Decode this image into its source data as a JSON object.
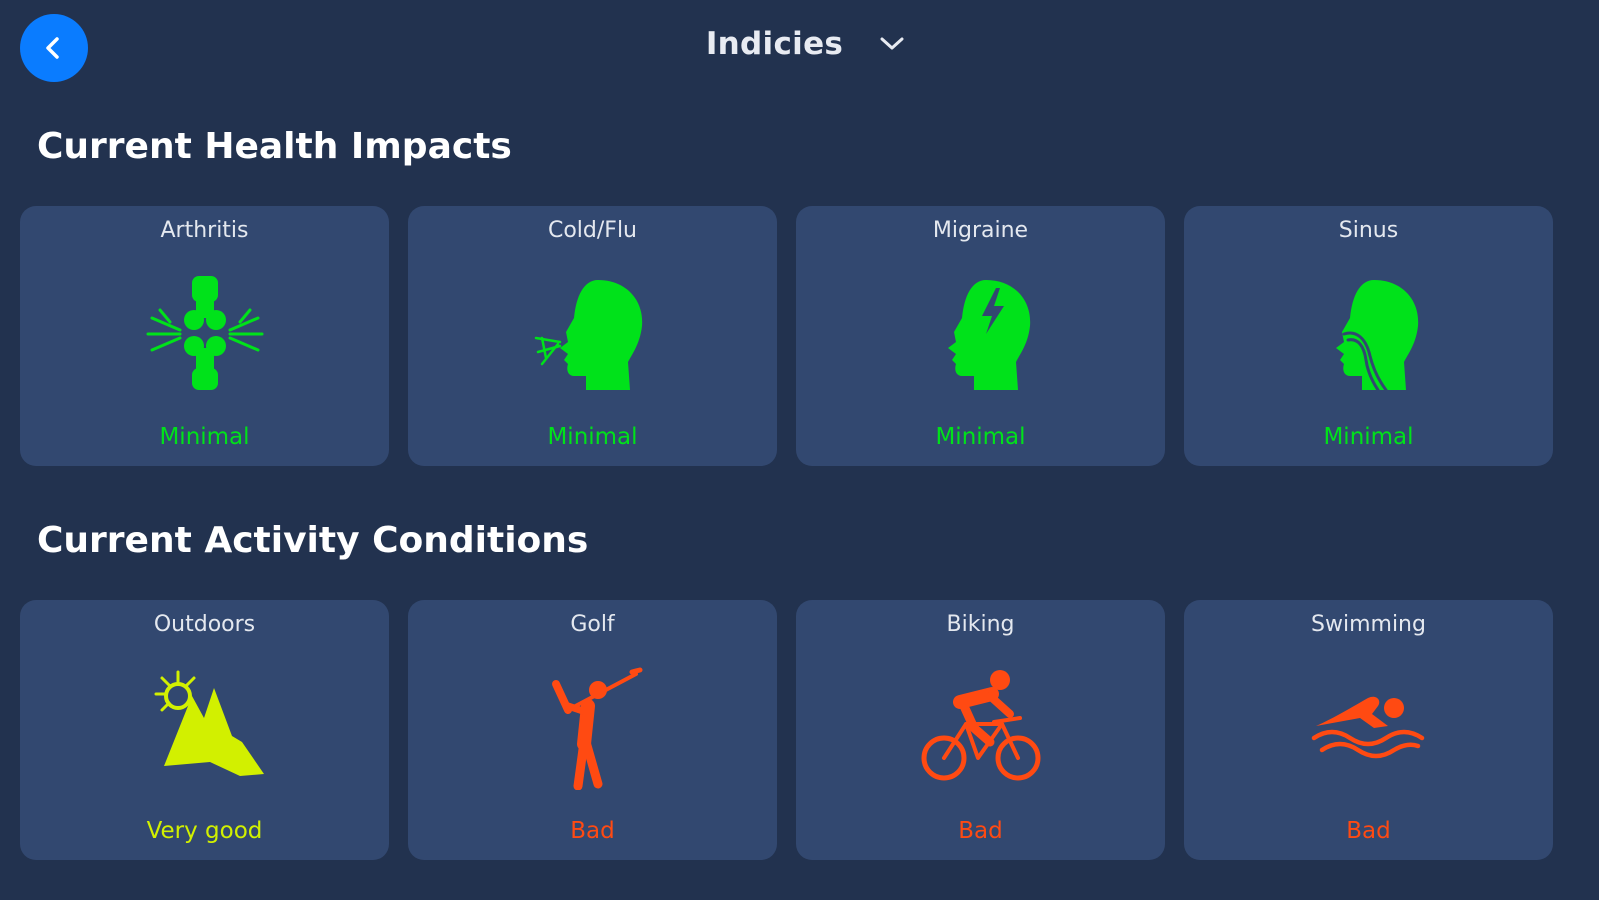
{
  "header": {
    "back_icon": "chevron-left-icon",
    "title": "Indicies",
    "dropdown_icon": "chevron-down-icon"
  },
  "colors": {
    "background": "#22324f",
    "card": "#324870",
    "accent_blue": "#0a7cff",
    "minimal": "#00e21a",
    "very_good": "#d2f000",
    "bad": "#ff4a12"
  },
  "health": {
    "title": "Current Health Impacts",
    "cards": [
      {
        "label": "Arthritis",
        "status": "Minimal",
        "icon": "joint-icon"
      },
      {
        "label": "Cold/Flu",
        "status": "Minimal",
        "icon": "sneezing-head-icon"
      },
      {
        "label": "Migraine",
        "status": "Minimal",
        "icon": "head-lightning-icon"
      },
      {
        "label": "Sinus",
        "status": "Minimal",
        "icon": "head-sinus-icon"
      }
    ]
  },
  "activity": {
    "title": "Current Activity Conditions",
    "cards": [
      {
        "label": "Outdoors",
        "status": "Very good",
        "icon": "sun-mountain-icon"
      },
      {
        "label": "Golf",
        "status": "Bad",
        "icon": "golfer-icon"
      },
      {
        "label": "Biking",
        "status": "Bad",
        "icon": "cyclist-icon"
      },
      {
        "label": "Swimming",
        "status": "Bad",
        "icon": "swimmer-icon"
      }
    ]
  }
}
